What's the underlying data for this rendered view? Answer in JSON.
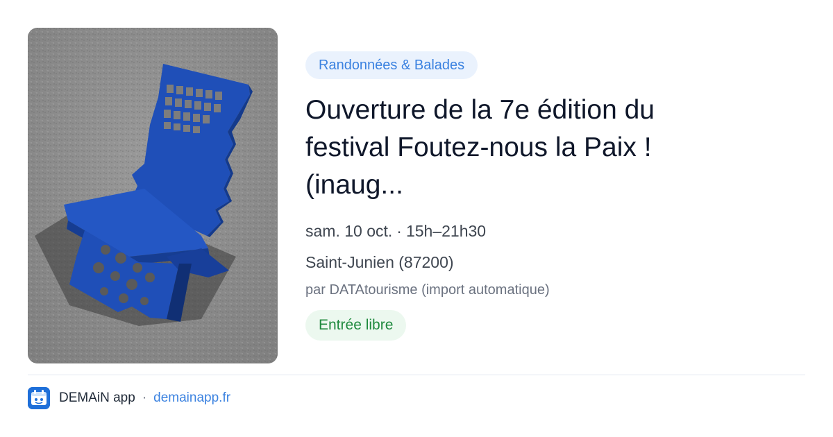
{
  "event": {
    "category": "Randonnées & Balades",
    "title": "Ouverture de la 7e édition du festival Foutez-nous la Paix ! (inaug...",
    "date": "sam. 10 oct.",
    "separator": "·",
    "time": "15h–21h30",
    "location": "Saint-Junien (87200)",
    "source": "par DATAtourisme (import automatique)",
    "price": "Entrée libre"
  },
  "image": {
    "alt": "Blue metal chair with face profile cut-out on asphalt"
  },
  "footer": {
    "app_name": "DEMAiN app",
    "separator": "·",
    "domain": "demainapp.fr",
    "logo_icon": "demain-app-logo-icon"
  },
  "colors": {
    "accent": "#3b82e0",
    "category_bg": "#eaf2fd",
    "price_text": "#1f8a3e",
    "price_bg": "#ecf8ef",
    "chair_blue": "#1f4fb8"
  }
}
